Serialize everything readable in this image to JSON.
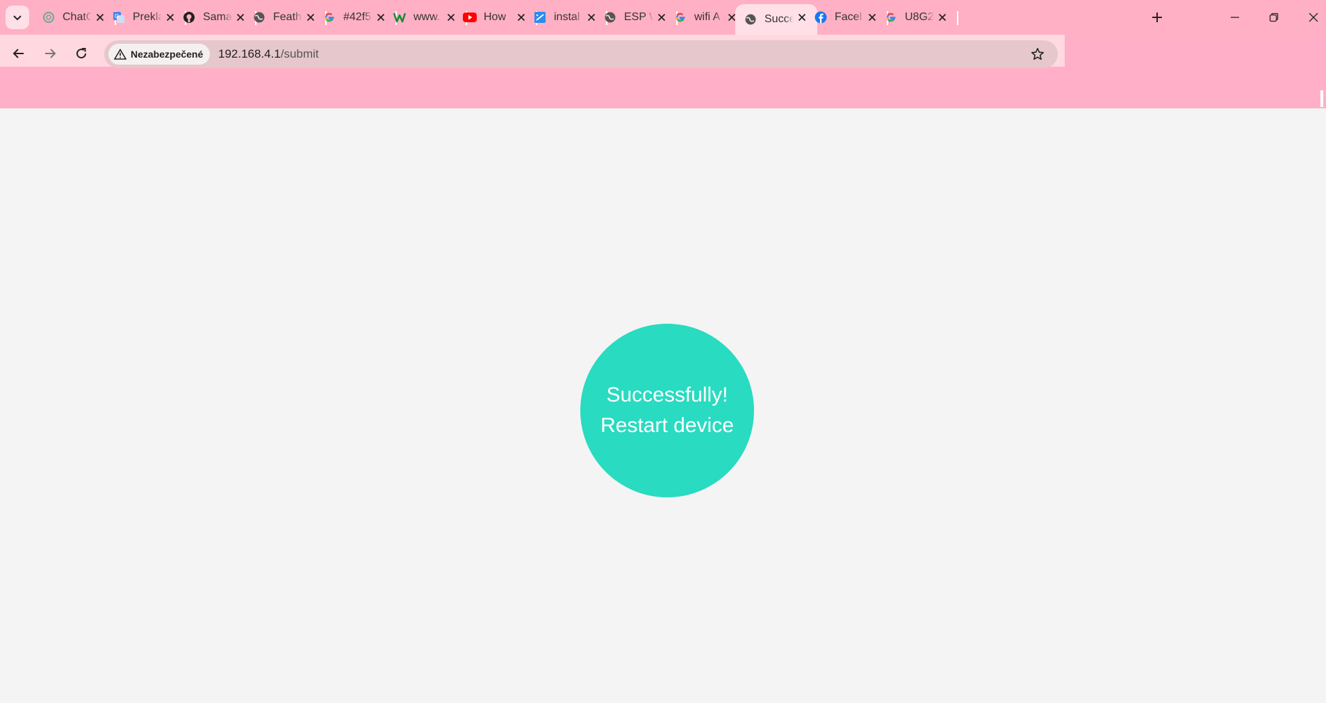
{
  "browser": {
    "tabs": [
      {
        "title": "ChatGPT",
        "icon": "chatgpt-icon",
        "active": false
      },
      {
        "title": "Preklad",
        "icon": "translate-icon",
        "active": false
      },
      {
        "title": "Samat",
        "icon": "github-icon",
        "active": false
      },
      {
        "title": "Feath",
        "icon": "globe-icon",
        "active": false
      },
      {
        "title": "#42f5",
        "icon": "google-icon",
        "active": false
      },
      {
        "title": "www.",
        "icon": "w-icon",
        "active": false
      },
      {
        "title": "How",
        "icon": "youtube-icon",
        "active": false
      },
      {
        "title": "instal",
        "icon": "docs-icon",
        "active": false
      },
      {
        "title": "ESP W",
        "icon": "globe-icon",
        "active": false
      },
      {
        "title": "wifi A",
        "icon": "google-icon",
        "active": false
      },
      {
        "title": "Succe",
        "icon": "globe-icon",
        "active": true
      },
      {
        "title": "Facel",
        "icon": "facebook-icon",
        "active": false
      },
      {
        "title": "U8G2",
        "icon": "google-icon",
        "active": false
      }
    ],
    "security_label": "Nezabezpečené",
    "url_host": "192.168.4.1",
    "url_path": "/submit",
    "colors": {
      "tabstrip": "#ffb0c4",
      "omnibox": "#e5c7cc",
      "accent": "#29dbc0"
    }
  },
  "page": {
    "line1": "Successfully!",
    "line2": "Restart device"
  }
}
